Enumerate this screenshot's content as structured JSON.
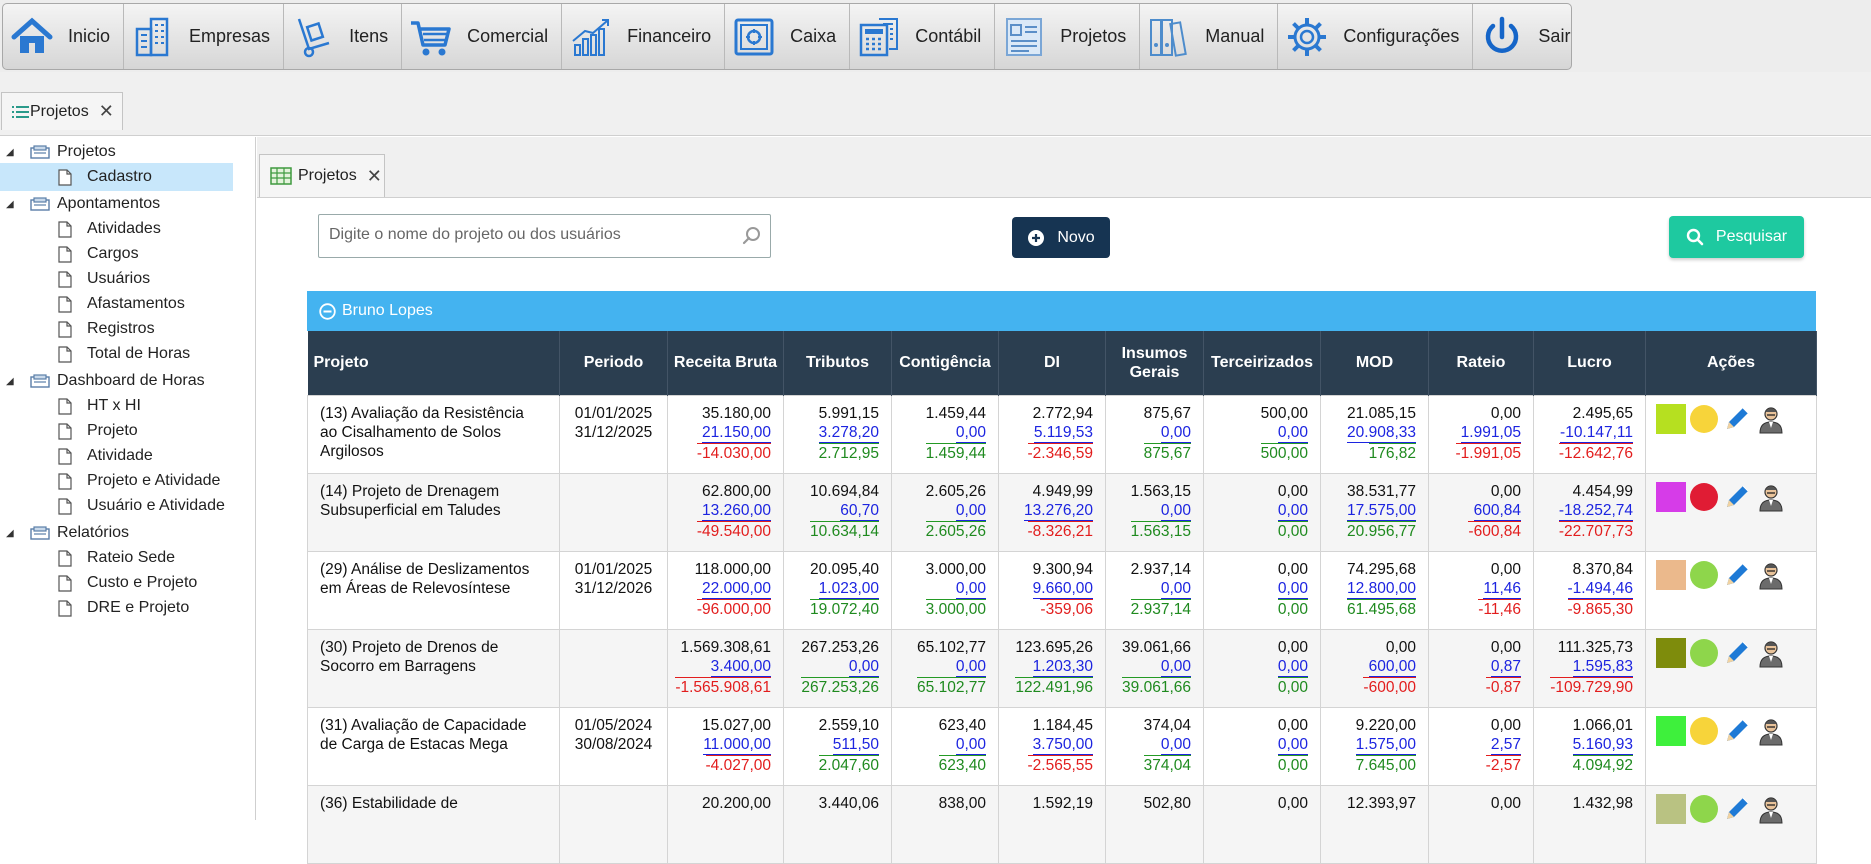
{
  "menu": [
    {
      "label": "Inicio",
      "icon": "home-icon"
    },
    {
      "label": "Empresas",
      "icon": "buildings-icon"
    },
    {
      "label": "Itens",
      "icon": "hand-truck-icon"
    },
    {
      "label": "Comercial",
      "icon": "cart-icon"
    },
    {
      "label": "Financeiro",
      "icon": "growth-chart-icon"
    },
    {
      "label": "Caixa",
      "icon": "safe-icon"
    },
    {
      "label": "Contábil",
      "icon": "calculator-icon"
    },
    {
      "label": "Projetos",
      "icon": "project-icon"
    },
    {
      "label": "Manual",
      "icon": "binders-icon"
    },
    {
      "label": "Configurações",
      "icon": "gear-icon"
    },
    {
      "label": "Sair",
      "icon": "power-icon"
    }
  ],
  "outer_tab": {
    "label": "Projetos",
    "close": "✕"
  },
  "tree": {
    "projetos": {
      "label": "Projetos",
      "items": [
        "Cadastro"
      ]
    },
    "apontamentos": {
      "label": "Apontamentos",
      "items": [
        "Atividades",
        "Cargos",
        "Usuários",
        "Afastamentos",
        "Registros",
        "Total de Horas"
      ]
    },
    "dashboard": {
      "label": "Dashboard de Horas",
      "items": [
        "HT x HI",
        "Projeto",
        "Atividade",
        "Projeto e Atividade",
        "Usuário e Atividade"
      ]
    },
    "relatorios": {
      "label": "Relatórios",
      "items": [
        "Rateio Sede",
        "Custo e Projeto",
        "DRE e Projeto"
      ]
    }
  },
  "inner_tab": {
    "label": "Projetos",
    "close": "✕"
  },
  "search": {
    "placeholder": "Digite o nome do projeto ou dos usuários"
  },
  "buttons": {
    "novo": "Novo",
    "pesquisar": "Pesquisar"
  },
  "group": {
    "label": "Bruno Lopes"
  },
  "table": {
    "headers": {
      "projeto": "Projeto",
      "periodo": "Periodo",
      "receita": "Receita Bruta",
      "tributos": "Tributos",
      "contigencia": "Contigência",
      "di": "DI",
      "insumos_1": "Insumos",
      "insumos_2": "Gerais",
      "terceirizados": "Terceirizados",
      "mod": "MOD",
      "rateio": "Rateio",
      "lucro": "Lucro",
      "acoes": "Ações"
    },
    "rows": [
      {
        "projeto": [
          "(13) Avaliação da Resistência",
          "ao Cisalhamento de Solos",
          "Argilosos"
        ],
        "periodo": [
          "01/01/2025",
          "31/12/2025"
        ],
        "receita": [
          "35.180,00",
          "21.150,00",
          "-14.030,00"
        ],
        "tributos": [
          "5.991,15",
          "3.278,20",
          "2.712,95"
        ],
        "contigencia": [
          "1.459,44",
          "0,00",
          "1.459,44"
        ],
        "di": [
          "2.772,94",
          "5.119,53",
          "-2.346,59"
        ],
        "insumos": [
          "875,67",
          "0,00",
          "875,67"
        ],
        "terceirizados": [
          "500,00",
          "0,00",
          "500,00"
        ],
        "mod": [
          "21.085,15",
          "20.908,33",
          "176,82"
        ],
        "rateio": [
          "0,00",
          "1.991,05",
          "-1.991,05"
        ],
        "lucro": [
          "2.495,65",
          "-10.147,11",
          "-12.642,76"
        ],
        "color_square": "#b6e020",
        "color_dot": "#f7d43a"
      },
      {
        "projeto": [
          "(14) Projeto de Drenagem",
          "Subsuperficial em Taludes"
        ],
        "periodo": [
          "",
          ""
        ],
        "receita": [
          "62.800,00",
          "13.260,00",
          "-49.540,00"
        ],
        "tributos": [
          "10.694,84",
          "60,70",
          "10.634,14"
        ],
        "contigencia": [
          "2.605,26",
          "0,00",
          "2.605,26"
        ],
        "di": [
          "4.949,99",
          "13.276,20",
          "-8.326,21"
        ],
        "insumos": [
          "1.563,15",
          "0,00",
          "1.563,15"
        ],
        "terceirizados": [
          "0,00",
          "0,00",
          "0,00"
        ],
        "mod": [
          "38.531,77",
          "17.575,00",
          "20.956,77"
        ],
        "rateio": [
          "0,00",
          "600,84",
          "-600,84"
        ],
        "lucro": [
          "4.454,99",
          "-18.252,74",
          "-22.707,73"
        ],
        "color_square": "#d63ce8",
        "color_dot": "#e01c34"
      },
      {
        "projeto": [
          "(29) Análise de Deslizamentos",
          "em Áreas de Relevosíntese"
        ],
        "periodo": [
          "01/01/2025",
          "31/12/2026"
        ],
        "receita": [
          "118.000,00",
          "22.000,00",
          "-96.000,00"
        ],
        "tributos": [
          "20.095,40",
          "1.023,00",
          "19.072,40"
        ],
        "contigencia": [
          "3.000,00",
          "0,00",
          "3.000,00"
        ],
        "di": [
          "9.300,94",
          "9.660,00",
          "-359,06"
        ],
        "insumos": [
          "2.937,14",
          "0,00",
          "2.937,14"
        ],
        "terceirizados": [
          "0,00",
          "0,00",
          "0,00"
        ],
        "mod": [
          "74.295,68",
          "12.800,00",
          "61.495,68"
        ],
        "rateio": [
          "0,00",
          "11,46",
          "-11,46"
        ],
        "lucro": [
          "8.370,84",
          "-1.494,46",
          "-9.865,30"
        ],
        "color_square": "#ebb98c",
        "color_dot": "#8ed64b"
      },
      {
        "projeto": [
          "(30) Projeto de Drenos de",
          "Socorro em Barragens"
        ],
        "periodo": [
          "",
          ""
        ],
        "receita": [
          "1.569.308,61",
          "3.400,00",
          "-1.565.908,61"
        ],
        "tributos": [
          "267.253,26",
          "0,00",
          "267.253,26"
        ],
        "contigencia": [
          "65.102,77",
          "0,00",
          "65.102,77"
        ],
        "di": [
          "123.695,26",
          "1.203,30",
          "122.491,96"
        ],
        "insumos": [
          "39.061,66",
          "0,00",
          "39.061,66"
        ],
        "terceirizados": [
          "0,00",
          "0,00",
          "0,00"
        ],
        "mod": [
          "0,00",
          "600,00",
          "-600,00"
        ],
        "rateio": [
          "0,00",
          "0,87",
          "-0,87"
        ],
        "lucro": [
          "111.325,73",
          "1.595,83",
          "-109.729,90"
        ],
        "color_square": "#7e8c0c",
        "color_dot": "#8ed64b"
      },
      {
        "projeto": [
          "(31) Avaliação de Capacidade",
          "de Carga de Estacas Mega"
        ],
        "periodo": [
          "01/05/2024",
          "30/08/2024"
        ],
        "receita": [
          "15.027,00",
          "11.000,00",
          "-4.027,00"
        ],
        "tributos": [
          "2.559,10",
          "511,50",
          "2.047,60"
        ],
        "contigencia": [
          "623,40",
          "0,00",
          "623,40"
        ],
        "di": [
          "1.184,45",
          "3.750,00",
          "-2.565,55"
        ],
        "insumos": [
          "374,04",
          "0,00",
          "374,04"
        ],
        "terceirizados": [
          "0,00",
          "0,00",
          "0,00"
        ],
        "mod": [
          "9.220,00",
          "1.575,00",
          "7.645,00"
        ],
        "rateio": [
          "0,00",
          "2,57",
          "-2,57"
        ],
        "lucro": [
          "1.066,01",
          "5.160,93",
          "4.094,92"
        ],
        "color_square": "#3ef03c",
        "color_dot": "#f7d43a"
      },
      {
        "projeto": [
          "(36) Estabilidade de",
          ""
        ],
        "periodo": [
          "",
          ""
        ],
        "receita": [
          "20.200,00",
          "",
          ""
        ],
        "tributos": [
          "3.440,06",
          "",
          ""
        ],
        "contigencia": [
          "838,00",
          "",
          ""
        ],
        "di": [
          "1.592,19",
          "",
          ""
        ],
        "insumos": [
          "502,80",
          "",
          ""
        ],
        "terceirizados": [
          "0,00",
          "",
          ""
        ],
        "mod": [
          "12.393,97",
          "",
          ""
        ],
        "rateio": [
          "0,00",
          "",
          ""
        ],
        "lucro": [
          "1.432,98",
          "",
          ""
        ],
        "color_square": "#b9c282",
        "color_dot": "#8ed64b"
      }
    ]
  }
}
